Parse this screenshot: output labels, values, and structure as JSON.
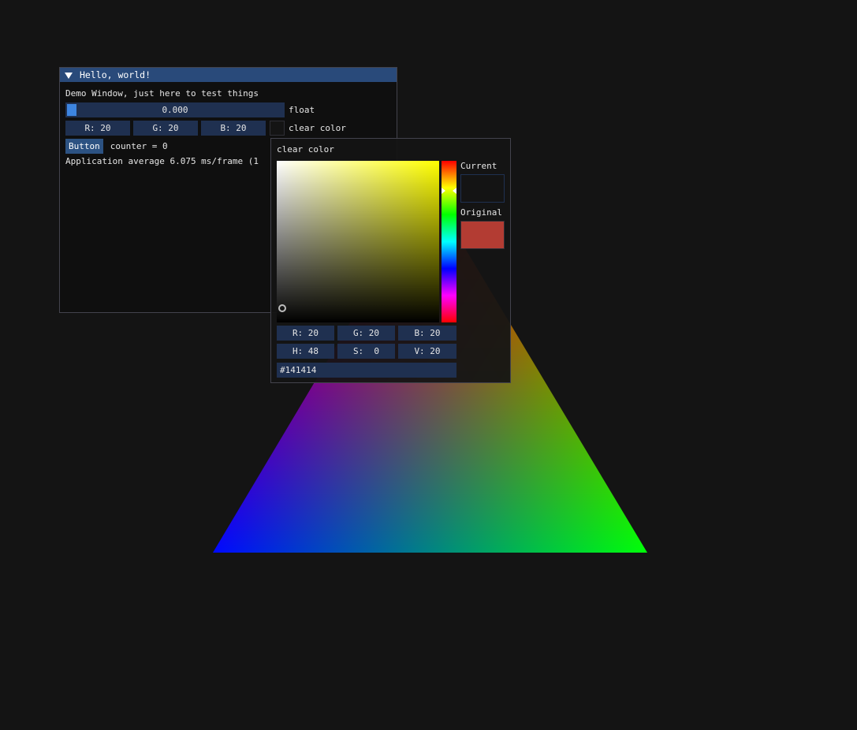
{
  "hello_window": {
    "title": "Hello, world!",
    "intro_text": "Demo Window, just here to test things",
    "float_slider": {
      "value_text": "0.000",
      "label": "float",
      "value": 0.0
    },
    "clear_color": {
      "r_text": "R: 20",
      "g_text": "G: 20",
      "b_text": "B: 20",
      "label": "clear color",
      "swatch_color": "#141414"
    },
    "button_label": "Button",
    "counter_text": "counter = 0",
    "perf_text": "Application average 6.075 ms/frame (1"
  },
  "color_picker": {
    "title": "clear color",
    "hue_color": "#ffff00",
    "current_label": "Current",
    "current_color": "#141414",
    "original_label": "Original",
    "original_color": "#b33c33",
    "rgb": {
      "r": "R: 20",
      "g": "G: 20",
      "b": "B: 20"
    },
    "hsv": {
      "h": "H: 48",
      "s": "S:  0",
      "v": "V: 20"
    },
    "hex": "#141414"
  },
  "scene": {
    "background": "#141414",
    "triangle_colors": {
      "top": "#ff0000",
      "bottom_left": "#0000ff",
      "bottom_right": "#00ff00"
    }
  }
}
